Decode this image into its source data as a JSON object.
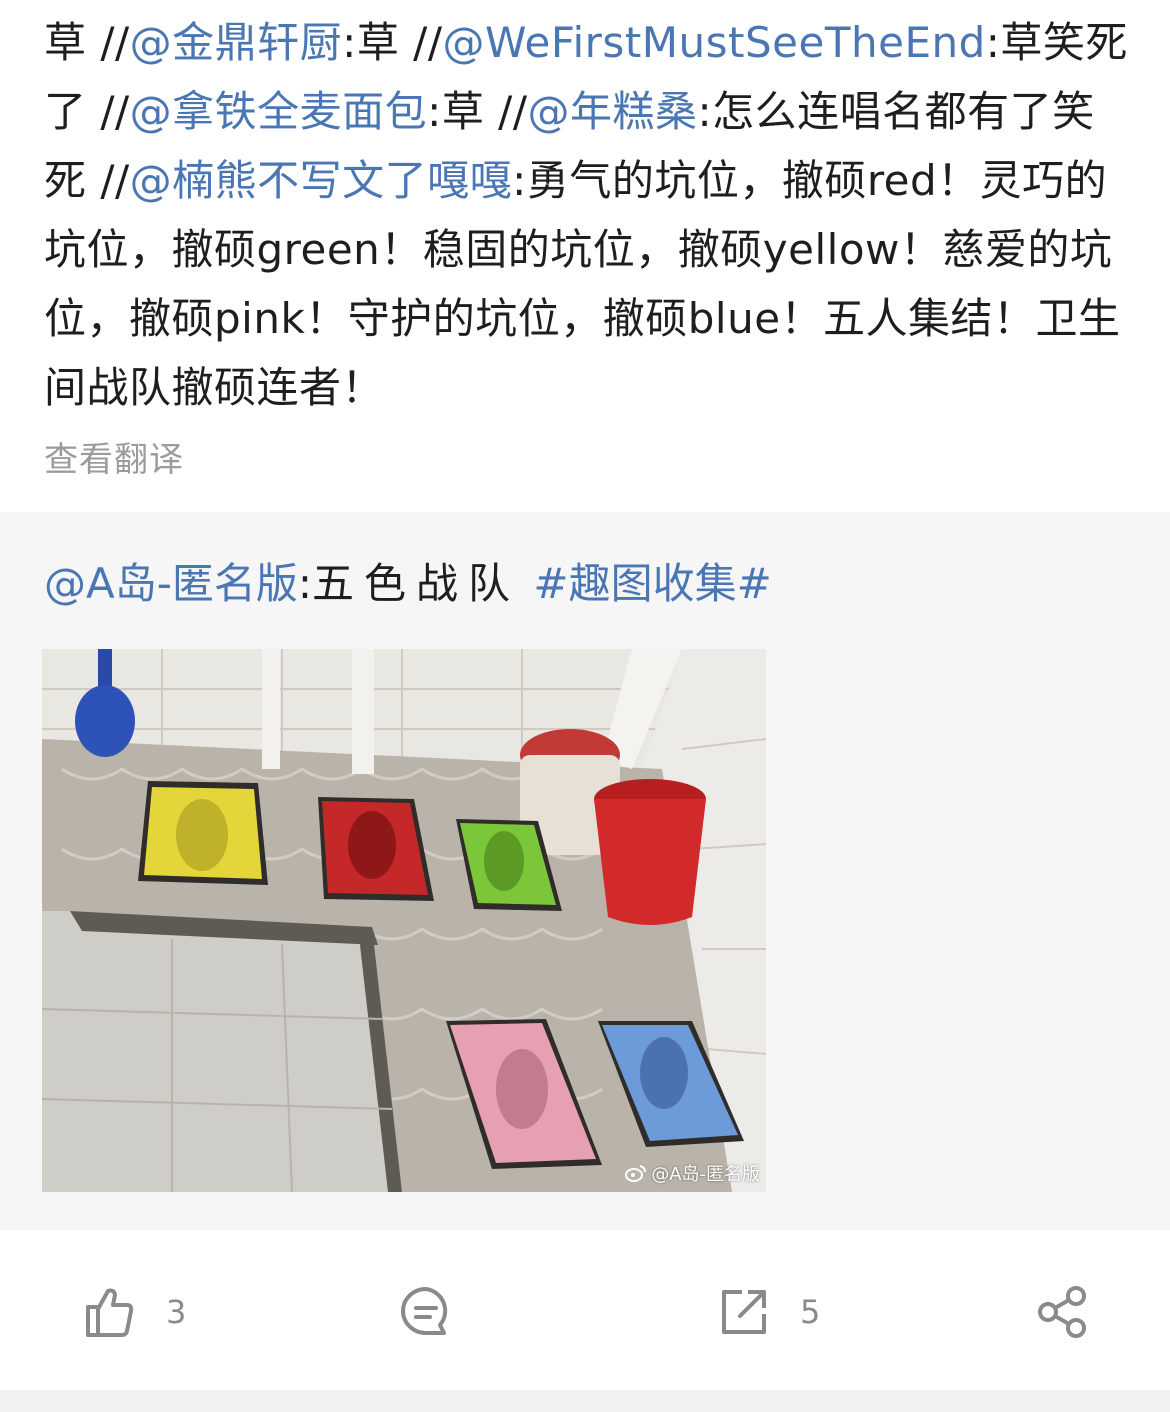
{
  "post": {
    "segments": [
      {
        "t": "草 //",
        "k": "text"
      },
      {
        "t": "@金鼎轩厨",
        "k": "mention"
      },
      {
        "t": ":草 //",
        "k": "text"
      },
      {
        "t": "@WeFirstMustSeeTheEnd",
        "k": "mention"
      },
      {
        "t": ":草笑死了 //",
        "k": "text"
      },
      {
        "t": "@拿铁全麦面包",
        "k": "mention"
      },
      {
        "t": ":草 //",
        "k": "text"
      },
      {
        "t": "@年糕桑",
        "k": "mention"
      },
      {
        "t": ":怎么连唱名都有了笑死 //",
        "k": "text"
      },
      {
        "t": "@楠熊不写文了嘎嘎",
        "k": "mention"
      },
      {
        "t": ":勇气的坑位，撤硕red！灵巧的坑位，撤硕green！稳固的坑位，撤硕yellow！慈爱的坑位，撤硕pink！守护的坑位，撤硕blue！五人集结！卫生间战队撤硕连者！",
        "k": "text"
      }
    ],
    "translate_label": "查看翻译"
  },
  "repost": {
    "author_mention": "@A岛-匿名版",
    "colon": ":",
    "body": "五色战队",
    "hashtag": "#趣图收集#",
    "image_watermark": "@A岛-匿名版",
    "image_colors": {
      "yellow": "#e3d53a",
      "red": "#c42828",
      "green": "#7cc63a",
      "pink": "#e6a0b2",
      "blue": "#6d9ad8"
    }
  },
  "actions": {
    "like_count": "3",
    "comment_count": "",
    "repost_count": "5"
  },
  "colors": {
    "mention": "#4a77b4",
    "icon": "#8a8a8a",
    "repost_bg": "#f6f6f6"
  }
}
